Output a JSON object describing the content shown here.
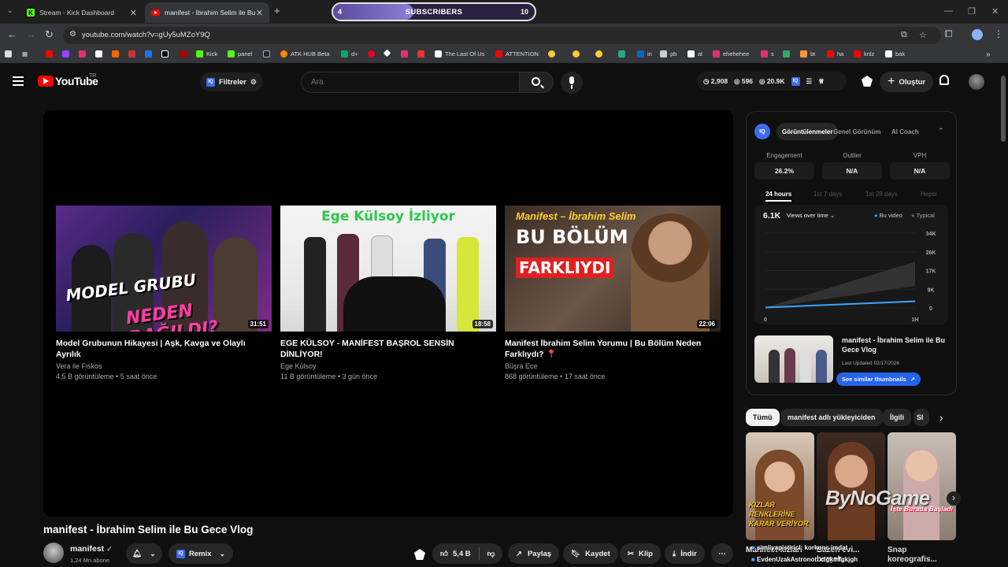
{
  "browser": {
    "tabs": [
      {
        "label": "Stream - Kick Dashboard",
        "active": false
      },
      {
        "label": "manifest - İbrahim Selim ile Bu",
        "active": true
      }
    ],
    "url": "youtube.com/watch?v=gUy5uMZoY9Q",
    "bookmarks": [
      "Kick",
      "panel",
      "ATK HUB Beta",
      "d+",
      "The Last Of Us",
      "ATTENTION",
      "in",
      "pb",
      "al",
      "ehehehee",
      "s",
      "bt",
      "ha",
      "knlz",
      "bak"
    ]
  },
  "subscriber_goal": {
    "label": "SUBSCRIBERS",
    "current": "4",
    "goal": "10",
    "progress": 0.4
  },
  "youtube": {
    "logo": "YouTube",
    "region": "TR",
    "filters_label": "Filtreler",
    "search_placeholder": "Ara",
    "stats": {
      "views": "2,908",
      "likes": "596",
      "subs": "20.9K"
    },
    "create_label": "Oluştur"
  },
  "endcards": [
    {
      "title": "Model Grubunun Hikayesi | Aşk, Kavga ve Olaylı Ayrılık",
      "channel": "Vera ile Fiskos",
      "meta": "4,5 B görüntüleme • 5 saat önce",
      "duration": "31:51",
      "thumb_text_1": "MODEL GRUBU",
      "thumb_text_2": "NEDEN DAĞILDI?"
    },
    {
      "title": "EGE KÜLSOY - MANİFEST BAŞROL SENSİN DİNLİYOR!",
      "channel": "Ege Külsoy",
      "meta": "11 B görüntüleme • 3 gün önce",
      "duration": "18:58",
      "thumb_text_1": "Ege Külsoy İzliyor"
    },
    {
      "title": "Manifest İbrahim Selim Yorumu | Bu Bölüm Neden Farklıydı? 📍",
      "channel": "Büşra Ece",
      "meta": "868 görüntüleme • 17 saat önce",
      "duration": "22:06",
      "thumb_text_1": "Manifest – İbrahim Selim",
      "thumb_text_2": "BU BÖLÜM",
      "thumb_text_3": "FARKLIYDI"
    }
  ],
  "video": {
    "title": "manifest - İbrahim Selim ile Bu Gece Vlog",
    "channel": "manifest",
    "subscribers": "1,24 Mn abone",
    "remix_label": "Remix",
    "likes": "5,4 B",
    "share_label": "Paylaş",
    "save_label": "Kaydet",
    "clip_label": "Klip",
    "download_label": "İndir"
  },
  "iq_panel": {
    "tabs": [
      "Görüntülenmeler",
      "Genel Görünüm",
      "AI Coach"
    ],
    "metrics": [
      {
        "label": "Engagement",
        "value": "26.2%"
      },
      {
        "label": "Outlier",
        "value": "N/A"
      },
      {
        "label": "VPH",
        "value": "N/A"
      }
    ],
    "ranges": [
      "24 hours",
      "1st 7 days",
      "1st 28 days",
      "Hepsi"
    ],
    "chart_header_value": "6.1K",
    "chart_dropdown": "Views over time",
    "legend": [
      "Bu video",
      "Typical"
    ],
    "similar": {
      "title": "manifest - İbrahim Selim ile Bu Gece Vlog",
      "updated": "Last Updated 02/17/2026",
      "button": "See similar thumbnails"
    }
  },
  "chart_data": {
    "type": "area",
    "x": [
      "0",
      "1H"
    ],
    "y_ticks": [
      "34K",
      "26K",
      "17K",
      "9K",
      "0"
    ],
    "ylim": [
      0,
      34000
    ],
    "series": [
      {
        "name": "Bu video",
        "values": [
          200,
          3000
        ]
      },
      {
        "name": "Typical",
        "values": [
          200,
          21000
        ],
        "band_low": [
          0,
          10000
        ]
      }
    ],
    "legend_position": "top-right"
  },
  "chips": [
    "Tümü",
    "manifest adlı yükleyiciden",
    "İlgili",
    "Sl"
  ],
  "shorts": [
    {
      "thumb_text": "KIZLAR RENKLERİNE KARAR VERİYOR",
      "caption": "Manifest kızları"
    },
    {
      "thumb_text": "",
      "caption": "Bazen evi... berşek..."
    },
    {
      "thumb_text": "İşte Burada Başladı",
      "caption": "Snap koreografis..."
    }
  ],
  "overlays": {
    "watermark": "ByNoGame",
    "chat_line_1": "simliyapistiricl: korkunc imdat",
    "chat_line_2": "EvdenUzakAstronot: clgkmfgkjgh"
  }
}
